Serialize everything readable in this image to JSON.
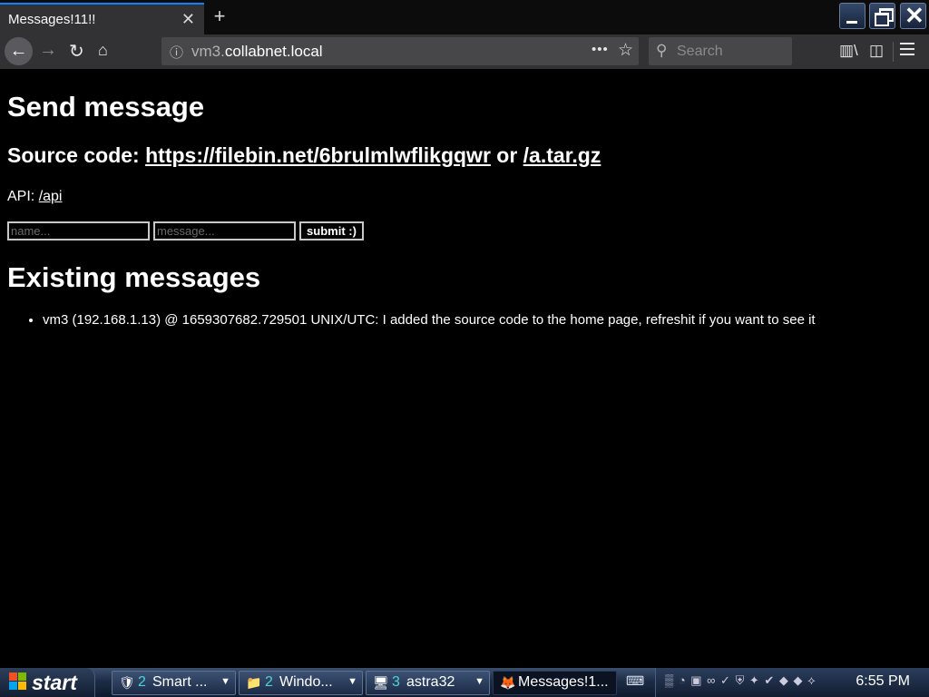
{
  "browser": {
    "tab_title": "Messages!11!!",
    "tab_close": "✕",
    "new_tab": "+",
    "url_host_prefix": "vm3.",
    "url_host_main": "collabnet.local",
    "page_actions": "•••",
    "search_placeholder": "Search"
  },
  "page": {
    "heading_send": "Send message",
    "source_prefix": "Source code: ",
    "source_link": "https://filebin.net/6brulmlwflikgqwr",
    "source_or": " or ",
    "source_tar": "/a.tar.gz",
    "api_prefix": "API: ",
    "api_link": "/api",
    "name_placeholder": "name...",
    "message_placeholder": "message...",
    "submit_label": "submit :)",
    "heading_existing": "Existing messages",
    "messages": [
      "vm3 (192.168.1.13) @ 1659307682.729501 UNIX/UTC: I added the source code to the home page, refreshit if you want to see it"
    ]
  },
  "taskbar": {
    "start_label": "start",
    "buttons": [
      {
        "count": "2",
        "label": "Smart ..."
      },
      {
        "count": "2",
        "label": "Windo..."
      },
      {
        "count": "3",
        "label": "astra32"
      },
      {
        "label": "Messages!1..."
      }
    ],
    "clock": "6:55 PM"
  }
}
